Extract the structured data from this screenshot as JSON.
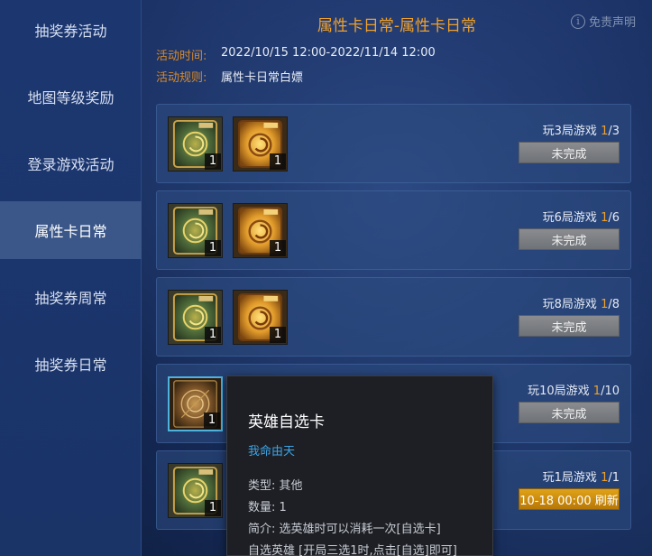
{
  "sidebar": {
    "items": [
      {
        "label": "抽奖券活动"
      },
      {
        "label": "地图等级奖励"
      },
      {
        "label": "登录游戏活动"
      },
      {
        "label": "属性卡日常"
      },
      {
        "label": "抽奖券周常"
      },
      {
        "label": "抽奖券日常"
      }
    ],
    "active_index": 3
  },
  "header": {
    "title": "属性卡日常-属性卡日常",
    "disclaimer": "免责声明",
    "info_icon": "i"
  },
  "meta": {
    "time_label": "活动时间:",
    "time_value": "2022/10/15 12:00-2022/11/14 12:00",
    "rule_label": "活动规则:",
    "rule_value": "属性卡日常白嫖"
  },
  "tasks": [
    {
      "req_prefix": "玩3局游戏 ",
      "progress_done": "1",
      "progress_total": "/3",
      "status": "未完成",
      "rewards": [
        {
          "icon": "green-card-icon",
          "qty": "1"
        },
        {
          "icon": "gold-card-icon",
          "qty": "1"
        }
      ]
    },
    {
      "req_prefix": "玩6局游戏 ",
      "progress_done": "1",
      "progress_total": "/6",
      "status": "未完成",
      "rewards": [
        {
          "icon": "green-card-icon",
          "qty": "1"
        },
        {
          "icon": "gold-card-icon",
          "qty": "1"
        }
      ]
    },
    {
      "req_prefix": "玩8局游戏 ",
      "progress_done": "1",
      "progress_total": "/8",
      "status": "未完成",
      "rewards": [
        {
          "icon": "green-card-icon",
          "qty": "1"
        },
        {
          "icon": "gold-card-icon",
          "qty": "1"
        }
      ]
    },
    {
      "req_prefix": "玩10局游戏 ",
      "progress_done": "1",
      "progress_total": "/10",
      "status": "未完成",
      "rewards": [
        {
          "icon": "hero-card-icon",
          "qty": "1"
        }
      ]
    },
    {
      "req_prefix": "玩1局游戏 ",
      "progress_done": "1",
      "progress_total": "/1",
      "status": "10-18 00:00 刷新",
      "rewards": [
        {
          "icon": "green-card-icon",
          "qty": "1"
        }
      ]
    }
  ],
  "tooltip": {
    "title": "英雄自选卡",
    "subtitle": "我命由天",
    "type": "类型:  其他",
    "count": "数量:  1",
    "desc": "简介:  选英雄时可以消耗一次[自选卡]",
    "desc2": "自选英雄 [开局三选1时,点击[自选]即可]"
  },
  "colors": {
    "accent_orange": "#f0a02a",
    "link_blue": "#3fa4e6",
    "refresh_gold": "#e0a218"
  }
}
